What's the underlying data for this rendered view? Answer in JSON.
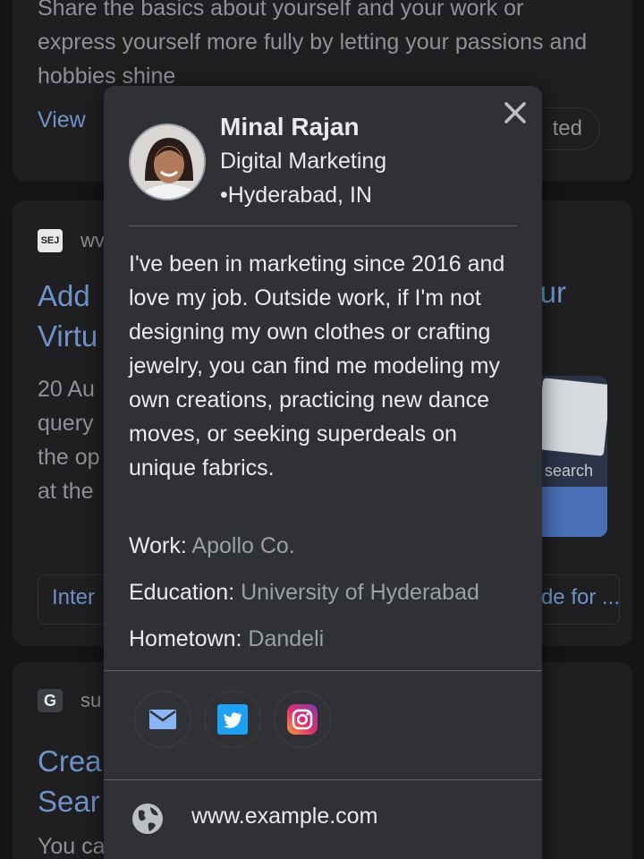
{
  "background": {
    "card1": {
      "description": "Share the basics about yourself and your work or express yourself more fully by letting your passions and hobbies shine",
      "view_link": "View",
      "pill_text": "ted"
    },
    "card2": {
      "favicon": "SEJ",
      "source": "wv",
      "title_line1": "Add",
      "title_line2": "Virtu",
      "title_right": "ur",
      "snippet": [
        "20 Au",
        "query",
        "the op",
        "at the"
      ],
      "thumbnail_text": "search",
      "chip_left": "Inter",
      "chip_right": "de for ..."
    },
    "card3": {
      "favicon": "G",
      "source": "su",
      "title_line1": "Crea",
      "title_line2": "Sear",
      "snippet": "You ca"
    }
  },
  "profile": {
    "name": "Minal Rajan",
    "role": "Digital Marketing",
    "location": "•Hyderabad, IN",
    "bio": "I've been in marketing since 2016 and love my job. Outside work, if I'm not designing my own clothes or crafting jewelry, you can find me modeling my own creations, practicing new dance moves, or seeking superdeals on unique fabrics.",
    "work_label": "Work:",
    "work_value": "Apollo Co.",
    "education_label": "Education:",
    "education_value": "University of Hyderabad",
    "hometown_label": "Hometown:",
    "hometown_value": "Dandeli",
    "social": [
      "email-icon",
      "twitter-icon",
      "instagram-icon"
    ],
    "website": "www.example.com"
  },
  "colors": {
    "background": "#151517",
    "card": "#1f1f21",
    "popup": "#303134",
    "link": "#6f93c9",
    "muted_text": "#9aa0a6",
    "twitter_blue": "#1da1f2"
  }
}
